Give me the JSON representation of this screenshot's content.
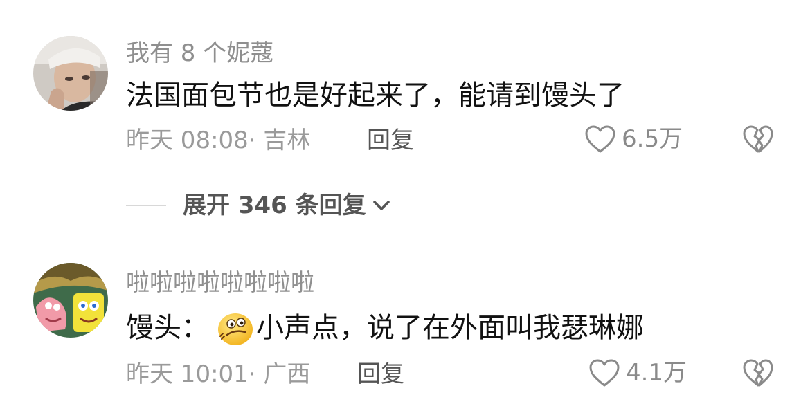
{
  "comments": [
    {
      "username": "我有 8 个妮蔻",
      "text": "法国面包节也是好起来了，能请到馒头了",
      "time": "昨天 08:08",
      "location": "· 吉林",
      "reply_label": "回复",
      "likes": "6.5万",
      "avatar_icon": "user-photo-avatar",
      "like_icon": "heart-outline-icon",
      "dislike_icon": "broken-heart-icon"
    },
    {
      "username": "啦啦啦啦啦啦啦啦",
      "text_prefix": "馒头：",
      "emoji_icon": "smirk-emoji",
      "text_suffix": "小声点，说了在外面叫我瑟琳娜",
      "time": "昨天 10:01",
      "location": "· 广西",
      "reply_label": "回复",
      "likes": "4.1万",
      "avatar_icon": "cartoon-avatar",
      "like_icon": "heart-outline-icon",
      "dislike_icon": "broken-heart-icon"
    }
  ],
  "expand": {
    "label": "展开 346 条回复",
    "icon": "chevron-down-icon"
  },
  "colors": {
    "username": "#8f8f8f",
    "text": "#111111",
    "meta": "#9a9a9a",
    "reply": "#555555"
  }
}
